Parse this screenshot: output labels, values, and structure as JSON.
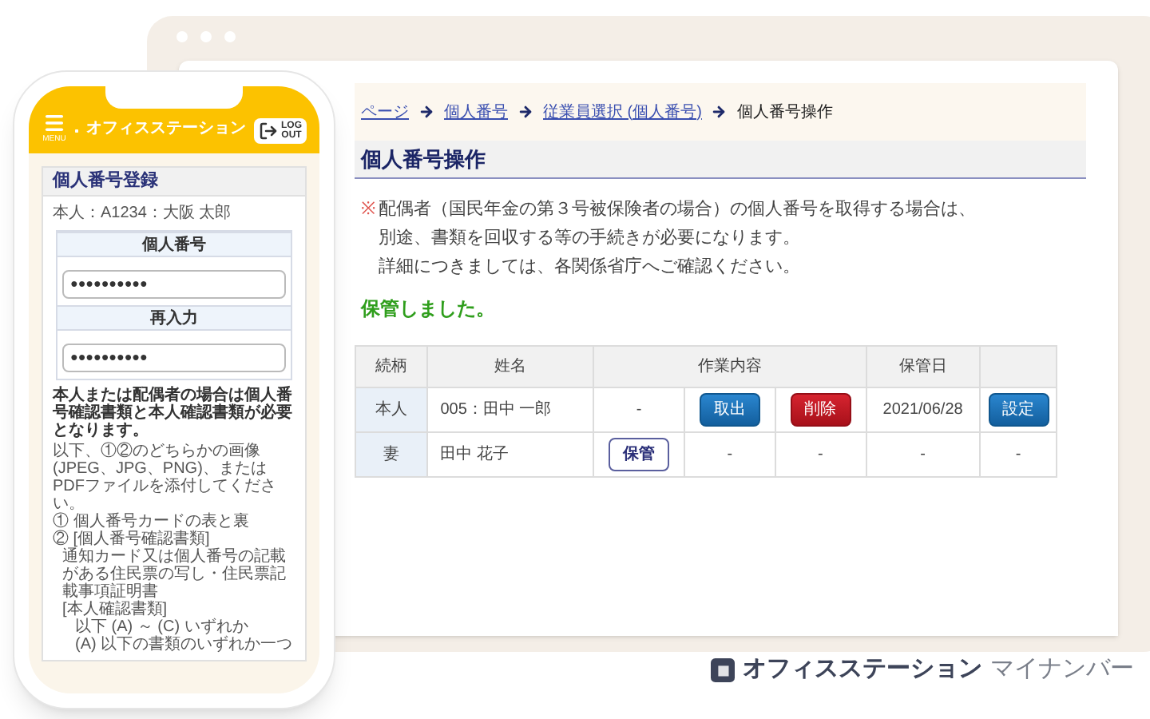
{
  "browser": {
    "breadcrumb": [
      {
        "label": "ページ",
        "link": true
      },
      {
        "label": "個人番号",
        "link": true
      },
      {
        "label": "従業員選択 (個人番号)",
        "link": true
      },
      {
        "label": "個人番号操作",
        "link": false
      }
    ],
    "heading": "個人番号操作",
    "notice": {
      "mark": "※",
      "lines": [
        "配偶者（国民年金の第３号被保険者の場合）の個人番号を取得する場合は、",
        "別途、書類を回収する等の手続きが必要になります。",
        "詳細につきましては、各関係省庁へご確認ください。"
      ]
    },
    "message": "保管しました。",
    "table": {
      "columns": [
        "続柄",
        "姓名",
        "作業内容",
        "保管日"
      ],
      "rows": [
        {
          "relation": "本人",
          "name": "005：田中 一郎",
          "work": [
            {
              "kind": "text",
              "text": "-"
            },
            {
              "kind": "primary_button",
              "text": "取出"
            },
            {
              "kind": "danger_button",
              "text": "削除"
            }
          ],
          "date": "2021/06/28",
          "column_5": {
            "kind": "primary_button",
            "text": "設定"
          }
        },
        {
          "relation": "妻",
          "name": "田中 花子",
          "work": [
            {
              "kind": "outline_button",
              "text": "保管"
            },
            {
              "kind": "text",
              "text": "-"
            },
            {
              "kind": "text",
              "text": "-"
            }
          ],
          "date": "-",
          "column_5": {
            "kind": "text",
            "text": "-"
          }
        }
      ]
    }
  },
  "phone": {
    "menu_label": "MENU",
    "app_name": "オフィスステーション",
    "logout_label": [
      "LOG",
      "OUT"
    ],
    "card_title": "個人番号登録",
    "person": "本人：A1234：大阪 太郎",
    "fields": [
      {
        "label": "個人番号",
        "value": "●●●●●●●●●●"
      },
      {
        "label": "再入力",
        "value": "●●●●●●●●●●"
      }
    ],
    "notes": [
      {
        "kind": "bold",
        "text": "本人または配偶者の場合は個人番号確認書類と本人確認書類が必要となります。"
      },
      {
        "kind": "plain",
        "text": "以下、①②のどちらかの画像(JPEG、JPG、PNG)、またはPDFファイルを添付してください。"
      },
      {
        "kind": "plain",
        "text": "① 個人番号カードの表と裏"
      },
      {
        "kind": "plain",
        "text": "② [個人番号確認書類]"
      },
      {
        "kind": "indent",
        "text": "通知カード又は個人番号の記載がある住民票の写し・住民票記載事項証明書"
      },
      {
        "kind": "indent",
        "text": "[本人確認書類]"
      },
      {
        "kind": "indent2",
        "text": "以下 (A) ～ (C) いずれか"
      },
      {
        "kind": "indent2",
        "text": "(A) 以下の書類のいずれか一つ"
      }
    ]
  },
  "footer": {
    "brand": "オフィスステーション",
    "product": "マイナンバー"
  }
}
